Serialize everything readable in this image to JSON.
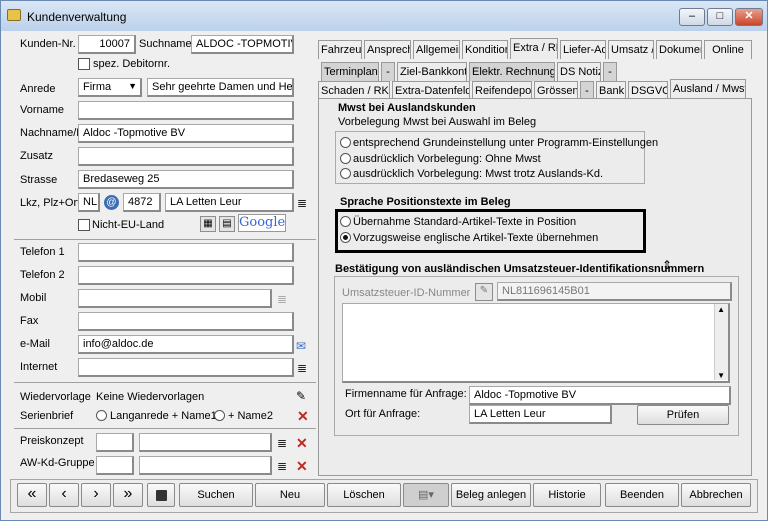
{
  "window": {
    "title": "Kundenverwaltung",
    "min_icon": "minimize-icon",
    "max_icon": "maximize-icon",
    "close_icon": "close-icon"
  },
  "left": {
    "kunden_nr_label": "Kunden-Nr.",
    "kunden_nr": "10007",
    "suchname_label": "Suchname",
    "suchname": "ALDOC -TOPMOTIVE",
    "spez_debitor": "spez. Debitornr.",
    "anrede_label": "Anrede",
    "anrede": "Firma",
    "briefanrede": "Sehr geehrte Damen und Herre",
    "vorname_label": "Vorname",
    "vorname": "",
    "nachname_label": "Nachname/F",
    "nachname": "Aldoc -Topmotive BV",
    "zusatz_label": "Zusatz",
    "zusatz": "",
    "strasse_label": "Strasse",
    "strasse": "Bredaseweg 25",
    "lkz_label": "Lkz, Plz+Ort",
    "lkz": "NL",
    "plz": "4872",
    "ort": "LA Letten Leur",
    "nicht_eu": "Nicht-EU-Land",
    "google": "Google",
    "telefon1_label": "Telefon 1",
    "telefon2_label": "Telefon 2",
    "mobil_label": "Mobil",
    "fax_label": "Fax",
    "email_label": "e-Mail",
    "email": "info@aldoc.de",
    "internet_label": "Internet",
    "wiedervorlage_label": "Wiedervorlage",
    "wiedervorlage_value": "Keine Wiedervorlagen",
    "serienbrief_label": "Serienbrief",
    "serienbrief_opt1": "Langanrede + Name1",
    "serienbrief_opt2": "+ Name2",
    "preiskonzept_label": "Preiskonzept",
    "awkd_label": "AW-Kd-Gruppe"
  },
  "tabs_row1": [
    "Fahrzeug",
    "Ansprech",
    "Allgemein",
    "Kondition",
    "Extra / RK",
    "Liefer-Adr",
    "Umsatz / I",
    "Dokumen",
    "Online"
  ],
  "tabs_row2": [
    "Terminplaner",
    "-",
    "Ziel-Bankkonto",
    "Elektr. Rechnungen",
    "DS Notiz",
    "-"
  ],
  "tabs_row3": [
    "Schaden / RKÜ",
    "Extra-Datenfelder",
    "Reifendepot",
    "Grössen",
    "-",
    "Bank",
    "DSGVO",
    "Ausland / Mwst"
  ],
  "panel": {
    "mwst_title": "Mwst bei Auslandskunden",
    "mwst_sub": "Vorbelegung Mwst bei Auswahl im Beleg",
    "mwst_opt1": "entsprechend Grundeinstellung unter Programm-Einstellungen",
    "mwst_opt2": "ausdrücklich Vorbelegung: Ohne Mwst",
    "mwst_opt3": "ausdrücklich Vorbelegung: Mwst trotz Auslands-Kd.",
    "sprache_title": "Sprache Positionstexte im Beleg",
    "sprache_opt1": "Übernahme Standard-Artikel-Texte in Position",
    "sprache_opt2": "Vorzugsweise englische Artikel-Texte übernehmen",
    "ust_title": "Bestätigung von ausländischen Umsatzsteuer-Identifikationsnummern",
    "ust_label": "Umsatzsteuer-ID-Nummer",
    "ust_value": "NL811696145B01",
    "firma_label": "Firmenname für Anfrage:",
    "firma_value": "Aldoc -Topmotive BV",
    "ort_label": "Ort für Anfrage:",
    "ort_value": "LA Letten Leur",
    "pruefen": "Prüfen"
  },
  "bottom": {
    "first": "«",
    "prev": "‹",
    "next": "›",
    "last": "»",
    "suchen": "Suchen",
    "neu": "Neu",
    "loeschen": "Löschen",
    "beleg": "Beleg anlegen",
    "historie": "Historie",
    "beenden": "Beenden",
    "abbrechen": "Abbrechen"
  }
}
